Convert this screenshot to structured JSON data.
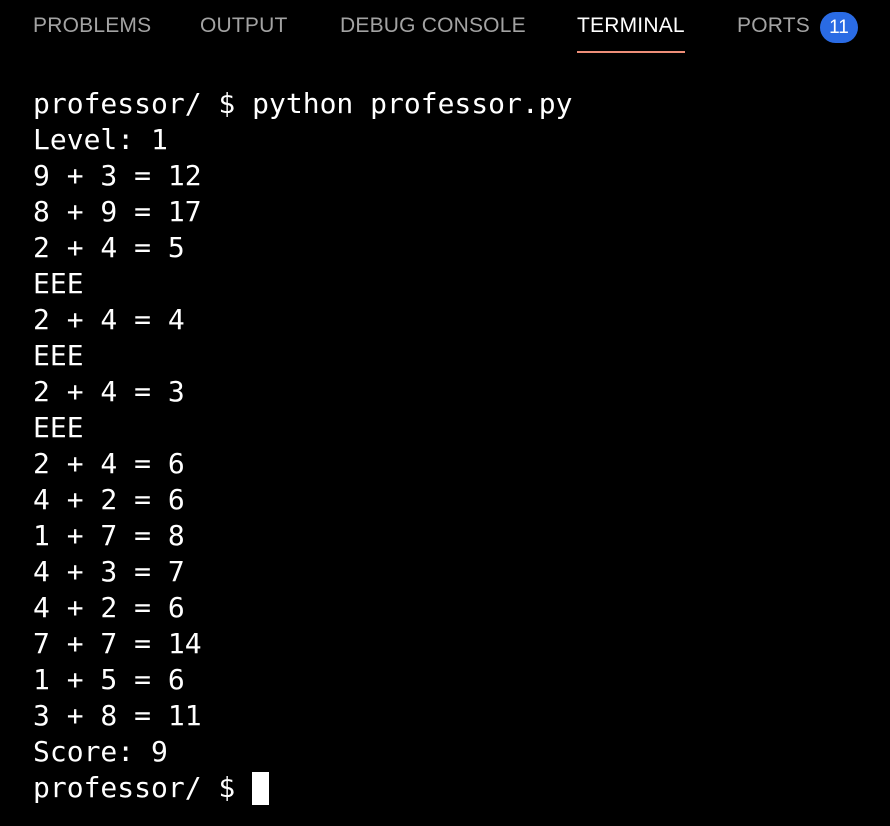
{
  "tabs": {
    "problems": "PROBLEMS",
    "output": "OUTPUT",
    "debug_console": "DEBUG CONSOLE",
    "terminal": "TERMINAL",
    "ports": "PORTS",
    "ports_badge": "11",
    "active": "TERMINAL"
  },
  "colors": {
    "background": "#000000",
    "text": "#ffffff",
    "inactive_tab": "#a3a3a3",
    "active_underline": "#ee8e78",
    "badge": "#2a6be4"
  },
  "terminal": {
    "lines": [
      "professor/ $ python professor.py",
      "Level: 1",
      "9 + 3 = 12",
      "8 + 9 = 17",
      "2 + 4 = 5",
      "EEE",
      "2 + 4 = 4",
      "EEE",
      "2 + 4 = 3",
      "EEE",
      "2 + 4 = 6",
      "4 + 2 = 6",
      "1 + 7 = 8",
      "4 + 3 = 7",
      "4 + 2 = 6",
      "7 + 7 = 14",
      "1 + 5 = 6",
      "3 + 8 = 11",
      "Score: 9"
    ],
    "prompt": "professor/ $"
  }
}
